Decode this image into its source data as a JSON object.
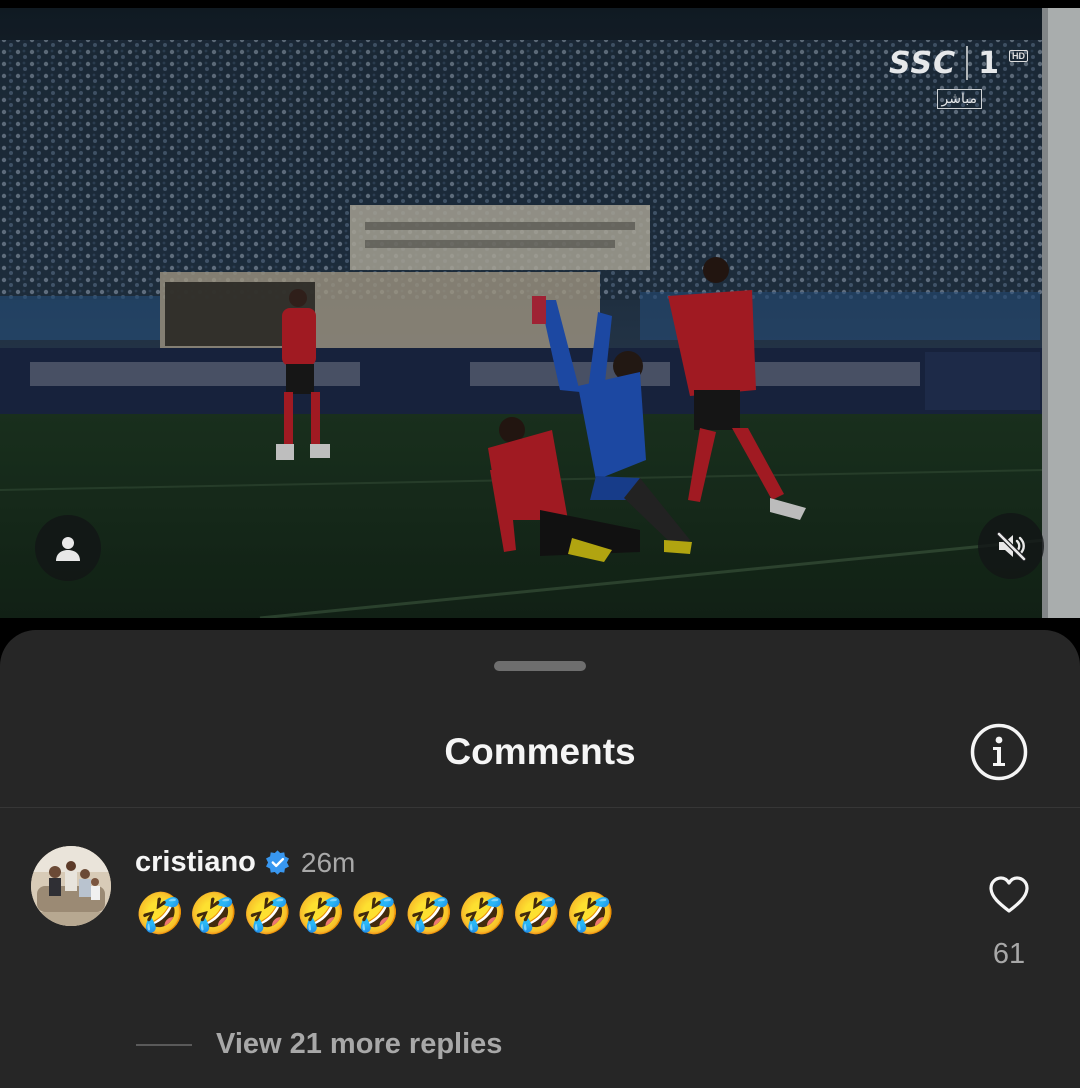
{
  "video": {
    "broadcaster_logo": "SSC",
    "channel_number": "1",
    "hd_badge": "HD",
    "live_label": "مباشر",
    "profile_button_icon": "person-icon",
    "mute_button_icon": "speaker-muted-icon"
  },
  "comments_sheet": {
    "title": "Comments",
    "info_icon": "info-circle-icon",
    "comment": {
      "username": "cristiano",
      "verified_icon": "verified-badge-icon",
      "time": "26m",
      "text": "🤣🤣🤣🤣🤣🤣🤣🤣🤣",
      "like_icon": "heart-outline-icon",
      "likes": "61"
    },
    "view_replies_label": "View 21 more replies"
  },
  "colors": {
    "sheet_background": "#262626",
    "verified_blue": "#3897f0",
    "secondary_text": "#a8a8a8"
  }
}
